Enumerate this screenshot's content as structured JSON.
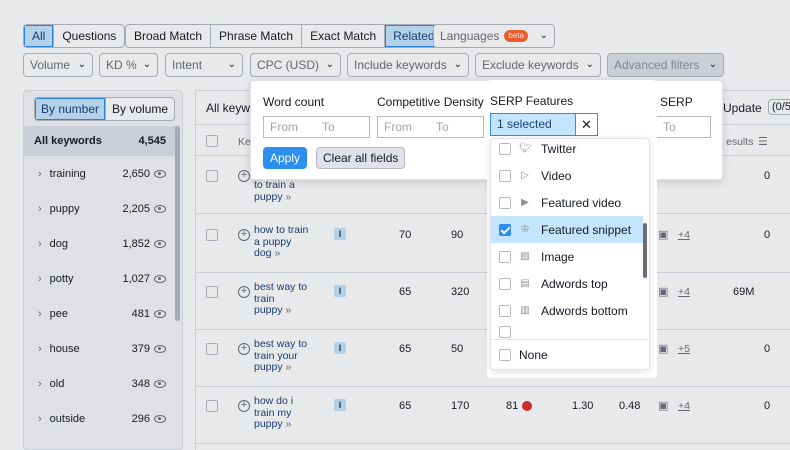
{
  "match_tabs": [
    {
      "label": "All",
      "selected": true
    },
    {
      "label": "Questions",
      "selected": false
    }
  ],
  "match_types": [
    {
      "label": "Broad Match",
      "selected": false
    },
    {
      "label": "Phrase Match",
      "selected": false
    },
    {
      "label": "Exact Match",
      "selected": false
    },
    {
      "label": "Related",
      "selected": true
    }
  ],
  "languages": {
    "label": "Languages",
    "badge": "beta"
  },
  "filters": {
    "volume": "Volume",
    "kd": "KD %",
    "intent": "Intent",
    "cpc": "CPC (USD)",
    "include": "Include keywords",
    "exclude": "Exclude keywords",
    "advanced": "Advanced filters"
  },
  "sidebar": {
    "by_number": "By number",
    "by_volume": "By volume",
    "all_label": "All keywords",
    "all_count": "4,545",
    "items": [
      {
        "name": "training",
        "count": "2,650"
      },
      {
        "name": "puppy",
        "count": "2,205"
      },
      {
        "name": "dog",
        "count": "1,852"
      },
      {
        "name": "potty",
        "count": "1,027"
      },
      {
        "name": "pee",
        "count": "481"
      },
      {
        "name": "house",
        "count": "379"
      },
      {
        "name": "old",
        "count": "348"
      },
      {
        "name": "outside",
        "count": "296"
      }
    ]
  },
  "table": {
    "header_all": "All keyw",
    "header_ke": "Ke",
    "header_update": "Update",
    "header_count": "(0/5",
    "header_results": "esults",
    "rows": [
      {
        "kw": [
          "to train a",
          "puppy"
        ],
        "chev": "»",
        "results": "0"
      },
      {
        "kw": [
          "how to train",
          "a puppy",
          "dog"
        ],
        "chev": "»",
        "intent": "I",
        "c1": "70",
        "c2": "90",
        "plus": "+4",
        "results": "0"
      },
      {
        "kw": [
          "best way to",
          "train",
          "puppy"
        ],
        "chev": "»",
        "intent": "I",
        "c1": "65",
        "c2": "320",
        "plus": "+4",
        "results": "69M"
      },
      {
        "kw": [
          "best way to",
          "train your",
          "puppy"
        ],
        "chev": "»",
        "intent": "I",
        "c1": "65",
        "c2": "50",
        "plus": "+5",
        "results": "0"
      },
      {
        "kw": [
          "how do i",
          "train my",
          "puppy"
        ],
        "chev": "»",
        "intent": "I",
        "c1": "65",
        "c2": "170",
        "kd": "81",
        "cpc": "1.30",
        "com": "0.48",
        "plus": "+4",
        "results": "0"
      }
    ]
  },
  "panel": {
    "word_count": "Word count",
    "comp_density": "Competitive Density",
    "serp_features": "SERP Features",
    "results_in": "Results in SERP",
    "from": "From",
    "to": "To",
    "apply": "Apply",
    "clear": "Clear all fields",
    "selected": "1 selected",
    "clear_x": "✕"
  },
  "serp_list": [
    {
      "label": "Twitter",
      "icon": "twitter-icon",
      "checked": false
    },
    {
      "label": "Video",
      "icon": "video-icon",
      "checked": false
    },
    {
      "label": "Featured video",
      "icon": "featured-video-icon",
      "checked": false
    },
    {
      "label": "Featured snippet",
      "icon": "featured-snippet-icon",
      "checked": true
    },
    {
      "label": "Image",
      "icon": "image-icon",
      "checked": false
    },
    {
      "label": "Adwords top",
      "icon": "adwords-top-icon",
      "checked": false
    },
    {
      "label": "Adwords bottom",
      "icon": "adwords-bottom-icon",
      "checked": false
    }
  ],
  "serp_none": "None",
  "colors": {
    "accent": "#2b8ff0",
    "selected_bg": "#c4e5fe",
    "red": "#e22d2d"
  }
}
